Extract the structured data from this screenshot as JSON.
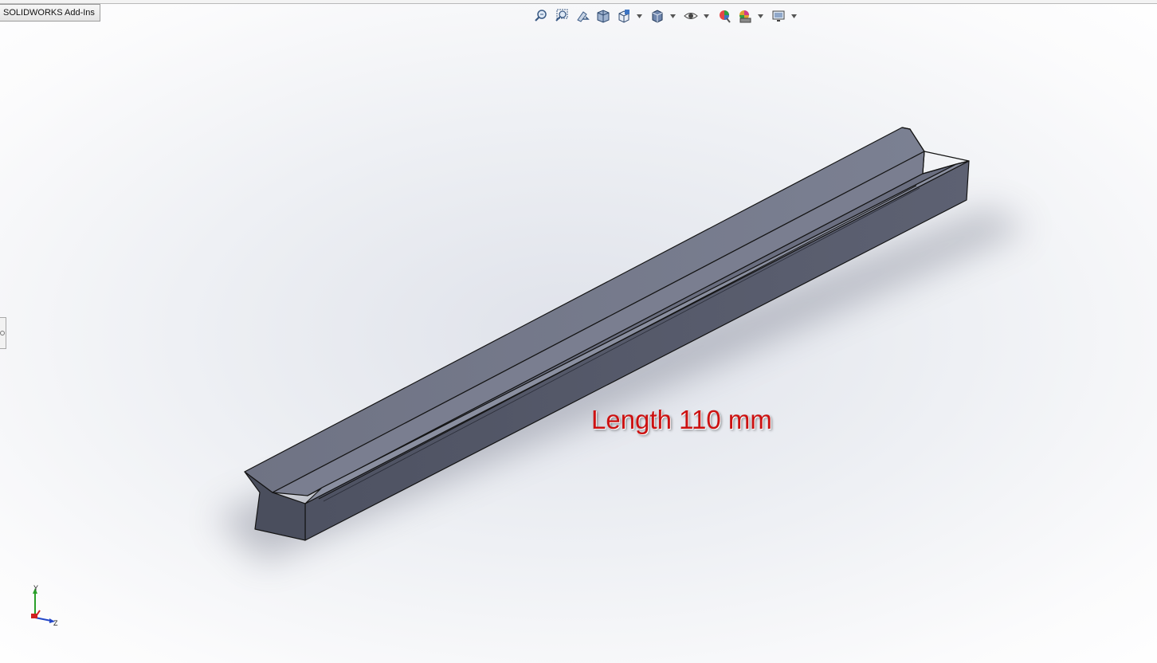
{
  "app": {
    "tab_label": "SOLIDWORKS Add-Ins"
  },
  "heads_up_toolbar": {
    "tools": [
      {
        "name": "zoom-to-fit-icon"
      },
      {
        "name": "zoom-to-area-icon"
      },
      {
        "name": "previous-view-icon"
      },
      {
        "name": "section-view-icon"
      },
      {
        "name": "view-orientation-icon"
      },
      {
        "name": "display-style-icon"
      },
      {
        "name": "hide-show-items-icon"
      },
      {
        "name": "edit-appearance-icon"
      },
      {
        "name": "apply-scene-icon"
      },
      {
        "name": "view-settings-icon"
      }
    ]
  },
  "annotation": {
    "length_text": "Length 110 mm",
    "color": "#cc1111"
  },
  "triad": {
    "x_label": "",
    "y_label": "Y",
    "z_label": "Z"
  },
  "colors": {
    "part_top": "#7c8092",
    "part_side": "#55596a",
    "part_edge": "#111111",
    "background_center": "#dfe2ea"
  }
}
